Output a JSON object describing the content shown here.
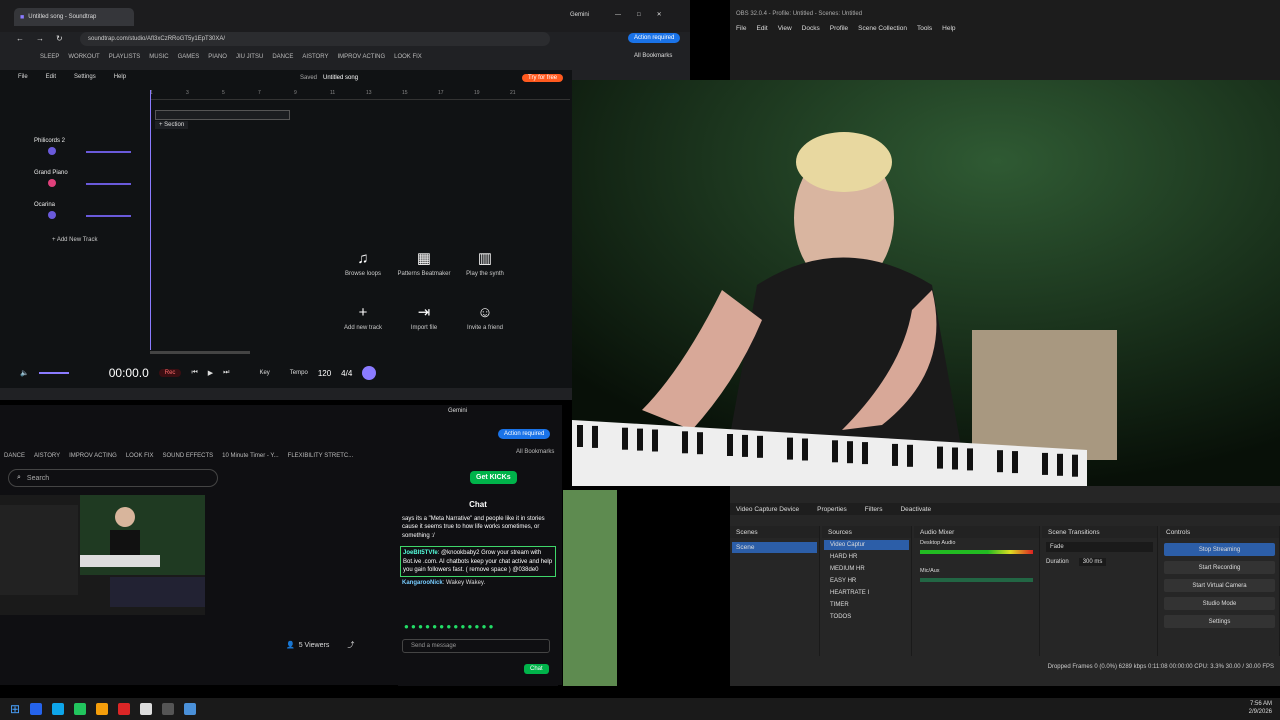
{
  "browser1": {
    "tab_title": "Untitled song - Soundtrap",
    "url": "soundtrap.com/studio/Afl3xCzRRoGT5y1EpT30XA/",
    "gemini": "Gemini",
    "action": "Action required",
    "bookmarks": [
      "SLEEP",
      "WORKOUT",
      "PLAYLISTS",
      "MUSIC",
      "GAMES",
      "PIANO",
      "JIU JITSU",
      "DANCE",
      "AISTORY",
      "IMPROV ACTING",
      "LOOK FIX"
    ],
    "all_bookmarks": "All Bookmarks"
  },
  "soundtrap": {
    "menu": [
      "File",
      "Edit",
      "Settings",
      "Help"
    ],
    "saved": "Saved",
    "song": "Untitled song",
    "try": "Try for free",
    "invite": "Invite",
    "section": "+ Section",
    "ticks": [
      "1",
      "3",
      "5",
      "7",
      "9",
      "11",
      "13",
      "15",
      "17",
      "19",
      "21"
    ],
    "tracks": [
      "Philicords 2",
      "Grand Piano",
      "Ocarina"
    ],
    "add_track": "+ Add New Track",
    "cards": [
      {
        "l": "Browse loops",
        "i": "♫"
      },
      {
        "l": "Patterns Beatmaker",
        "i": "▦"
      },
      {
        "l": "Play the synth",
        "i": "▥"
      },
      {
        "l": "Add new track",
        "i": "+"
      },
      {
        "l": "Import file",
        "i": "⇥"
      },
      {
        "l": "Invite a friend",
        "i": "☺"
      }
    ],
    "time": "00:00.0",
    "rec": "Rec",
    "key": "Key",
    "tempo_label": "Tempo",
    "tempo": "120",
    "sig": "4/4"
  },
  "obs": {
    "title": "OBS 32.0.4 - Profile: Untitled - Scenes: Untitled",
    "menu": [
      "File",
      "Edit",
      "View",
      "Docks",
      "Profile",
      "Scene Collection",
      "Tools",
      "Help"
    ],
    "src_bar": [
      "Video Capture Device",
      "Properties",
      "Filters",
      "Deactivate"
    ],
    "scenes_h": "Scenes",
    "scene": "Scene",
    "sources_h": "Sources",
    "sources": [
      "Video Captur",
      "HARD HR",
      "MEDIUM HR",
      "EASY HR",
      "HEARTRATE I",
      "TIMER",
      "TODOS"
    ],
    "mixer_h": "Audio Mixer",
    "desk": "Desktop Audio",
    "mic": "Mic/Aux",
    "desk_db": "-2.8 dB",
    "mic_db": "-inf dB",
    "trans_h": "Scene Transitions",
    "fade": "Fade",
    "dur_label": "Duration",
    "dur": "300 ms",
    "controls_h": "Controls",
    "controls": [
      "Stop Streaming",
      "Start Recording",
      "Start Virtual Camera",
      "Studio Mode",
      "Settings"
    ],
    "status": "Dropped Frames 0 (0.0%)   6289 kbps   0:11:08   00:00:00   CPU: 3.3%   30.00 / 30.00 FPS"
  },
  "browser2": {
    "gemini": "Gemini",
    "action": "Action required",
    "bookmarks": [
      "DANCE",
      "AISTORY",
      "IMPROV ACTING",
      "LOOK FIX",
      "SOUND EFFECTS",
      "10 Minute Timer - Y...",
      "FLEXIBILITY STRETC..."
    ],
    "all": "All Bookmarks",
    "search": "Search",
    "kicks": "Get KICKs",
    "viewers": "5 Viewers",
    "chat_title": "Chat",
    "msg1": "says its a \"Meta Narrative\" and people like it in stories cause it seems true to how life works sometimes, or something :/",
    "msg2_user": "JoeBlt5TVfe",
    "msg2": ": @knookbaby2 Grow your stream with Bot.ive .com. AI chatbots keep your chat active and help you gain followers fast. ( remove space ) @038de0",
    "msg3_user": "KangarooNick",
    "msg3": ": Wakey Wakey.",
    "send": "Send a message",
    "chat_btn": "Chat"
  },
  "taskbar": {
    "time": "7:56 AM",
    "date": "2/9/2026"
  }
}
